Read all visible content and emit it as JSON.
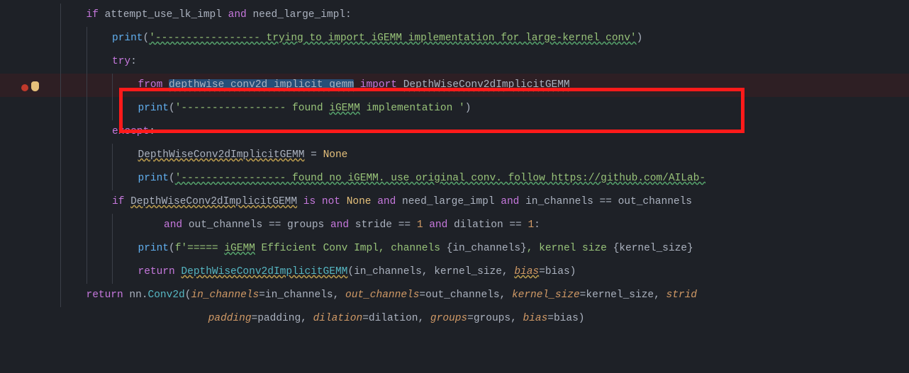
{
  "code": {
    "l1": {
      "if": "if",
      "v1": "attempt_use_lk_impl",
      "and": "and",
      "v2": "need_large_impl",
      "colon": ":"
    },
    "l2": {
      "fn": "print",
      "s": "'----------------- trying to import iGEMM implementation for large-kernel conv'"
    },
    "l3": {
      "try": "try",
      "colon": ":"
    },
    "l4": {
      "from": "from",
      "mod": "depthwise_conv2d_implicit_gemm",
      "imp": "import",
      "cls": "DepthWiseConv2dImplicitGEMM"
    },
    "l5": {
      "fn": "print",
      "s_a": "'----------------- found ",
      "s_b": "iGEMM",
      "s_c": " implementation '"
    },
    "l6": {
      "exc": "except",
      "colon": ":"
    },
    "l7": {
      "cls": "DepthWiseConv2dImplicitGEMM",
      "eq": " = ",
      "none": "None"
    },
    "l8": {
      "fn": "print",
      "s": "'----------------- found no iGEMM. use original conv. follow https://github.com/AILab-"
    },
    "l9": {
      "if": "if",
      "cls": "DepthWiseConv2dImplicitGEMM",
      "isnot": "is not",
      "none": "None",
      "and": "and",
      "v1": "need_large_impl",
      "and2": "and",
      "v2": "in_channels",
      "eq": "==",
      "v3": "out_channels"
    },
    "l10": {
      "and": "and",
      "v1": "out_channels",
      "eq": "==",
      "v2": "groups",
      "and2": "and",
      "v3": "stride",
      "eq2": "==",
      "n1": "1",
      "and3": "and",
      "v4": "dilation",
      "eq3": "==",
      "n2": "1",
      "colon": ":"
    },
    "l11": {
      "fn": "print",
      "pfx": "f'===== ",
      "s_a": "iGEMM",
      "s_b": " Efficient Conv Impl, channels ",
      "br1": "{",
      "v1": "in_channels",
      "br2": "}",
      "s_c": ", kernel size ",
      "br3": "{",
      "v2": "kernel_size",
      "br4": "}"
    },
    "l12": {
      "ret": "return",
      "cls": "DepthWiseConv2dImplicitGEMM",
      "a1": "in_channels",
      "c1": ", ",
      "a2": "kernel_size",
      "c2": ", ",
      "k": "bias",
      "eq": "=",
      "v": "bias"
    },
    "l13": {
      "ret": "return",
      "mod": "nn",
      "dot": ".",
      "fn": "Conv2d",
      "p1": "in_channels",
      "v1": "in_channels",
      "p2": "out_channels",
      "v2": "out_channels",
      "p3": "kernel_size",
      "v3": "kernel_size",
      "p4": "strid"
    },
    "l14": {
      "p1": "padding",
      "v1": "padding",
      "p2": "dilation",
      "v2": "dilation",
      "p3": "groups",
      "v3": "groups",
      "p4": "bias",
      "v4": "bias"
    }
  }
}
